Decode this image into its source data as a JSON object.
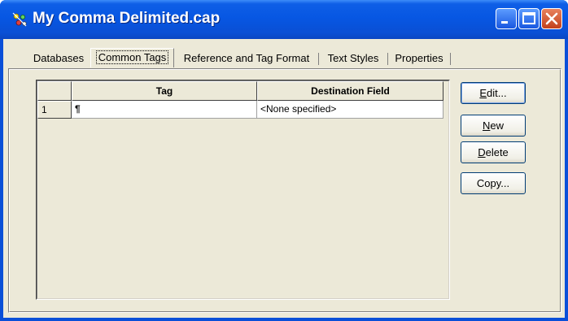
{
  "window": {
    "title": "My Comma Delimited.cap",
    "icon": "app-sparkle-icon"
  },
  "titlebar_controls": {
    "minimize": "minimize-icon",
    "maximize": "maximize-icon",
    "close": "close-icon"
  },
  "tabs": [
    {
      "label": "Databases",
      "active": false
    },
    {
      "label": "Common Tags",
      "active": true
    },
    {
      "label": "Reference and Tag Format",
      "active": false
    },
    {
      "label": "Text Styles",
      "active": false
    },
    {
      "label": "Properties",
      "active": false
    }
  ],
  "table": {
    "columns": [
      "",
      "Tag",
      "Destination Field"
    ],
    "rows": [
      {
        "num": "1",
        "tag": "¶",
        "destination": "<None specified>"
      }
    ]
  },
  "buttons": {
    "edit": {
      "mnemonic": "E",
      "rest": "dit..."
    },
    "new": {
      "mnemonic": "N",
      "rest": "ew"
    },
    "delete": {
      "mnemonic": "D",
      "rest": "elete"
    },
    "copy": {
      "label": "Copy..."
    }
  },
  "colors": {
    "titlebar": "#0757e3",
    "client": "#ece9d8"
  }
}
